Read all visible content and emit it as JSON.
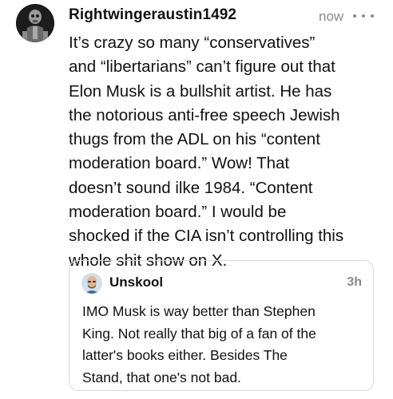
{
  "post": {
    "username": "Rightwingeraustin1492",
    "time": "now",
    "avatar_icon": "skull-figure-avatar-icon",
    "more_icon": "more-options-icon",
    "lines": [
      "It’s crazy so many “conservatives”",
      "and “libertarians”  can’t figure out that",
      "Elon Musk is a bullshit artist.  He has",
      "the notorious anti-free speech Jewish",
      "thugs from the ADL on his “content",
      "moderation board.”   Wow!  That",
      "doesn’t sound  ilke 1984.  “Content",
      "moderation board.”  I would be",
      "shocked if the CIA isn’t controlling this",
      "whole shit show on X."
    ]
  },
  "quoted": {
    "username": "Unskool",
    "time": "3h",
    "avatar_icon": "bald-man-avatar-icon",
    "lines": [
      "IMO Musk is way better than Stephen",
      "King. Not really that big of a fan of the",
      "latter's books either. Besides The",
      "Stand, that one's not bad."
    ]
  }
}
